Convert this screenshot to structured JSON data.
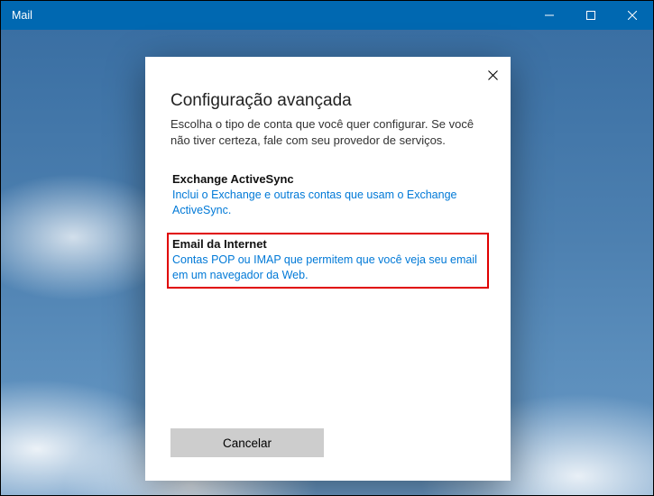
{
  "window": {
    "title": "Mail"
  },
  "dialog": {
    "title": "Configuração avançada",
    "subtitle": "Escolha o tipo de conta que você quer configurar. Se você não tiver certeza, fale com seu provedor de serviços.",
    "options": [
      {
        "title": "Exchange ActiveSync",
        "desc": "Inclui o Exchange e outras contas que usam o Exchange ActiveSync."
      },
      {
        "title": "Email da Internet",
        "desc": "Contas POP ou IMAP que permitem que você veja seu email em um navegador da Web."
      }
    ],
    "cancel_label": "Cancelar"
  }
}
